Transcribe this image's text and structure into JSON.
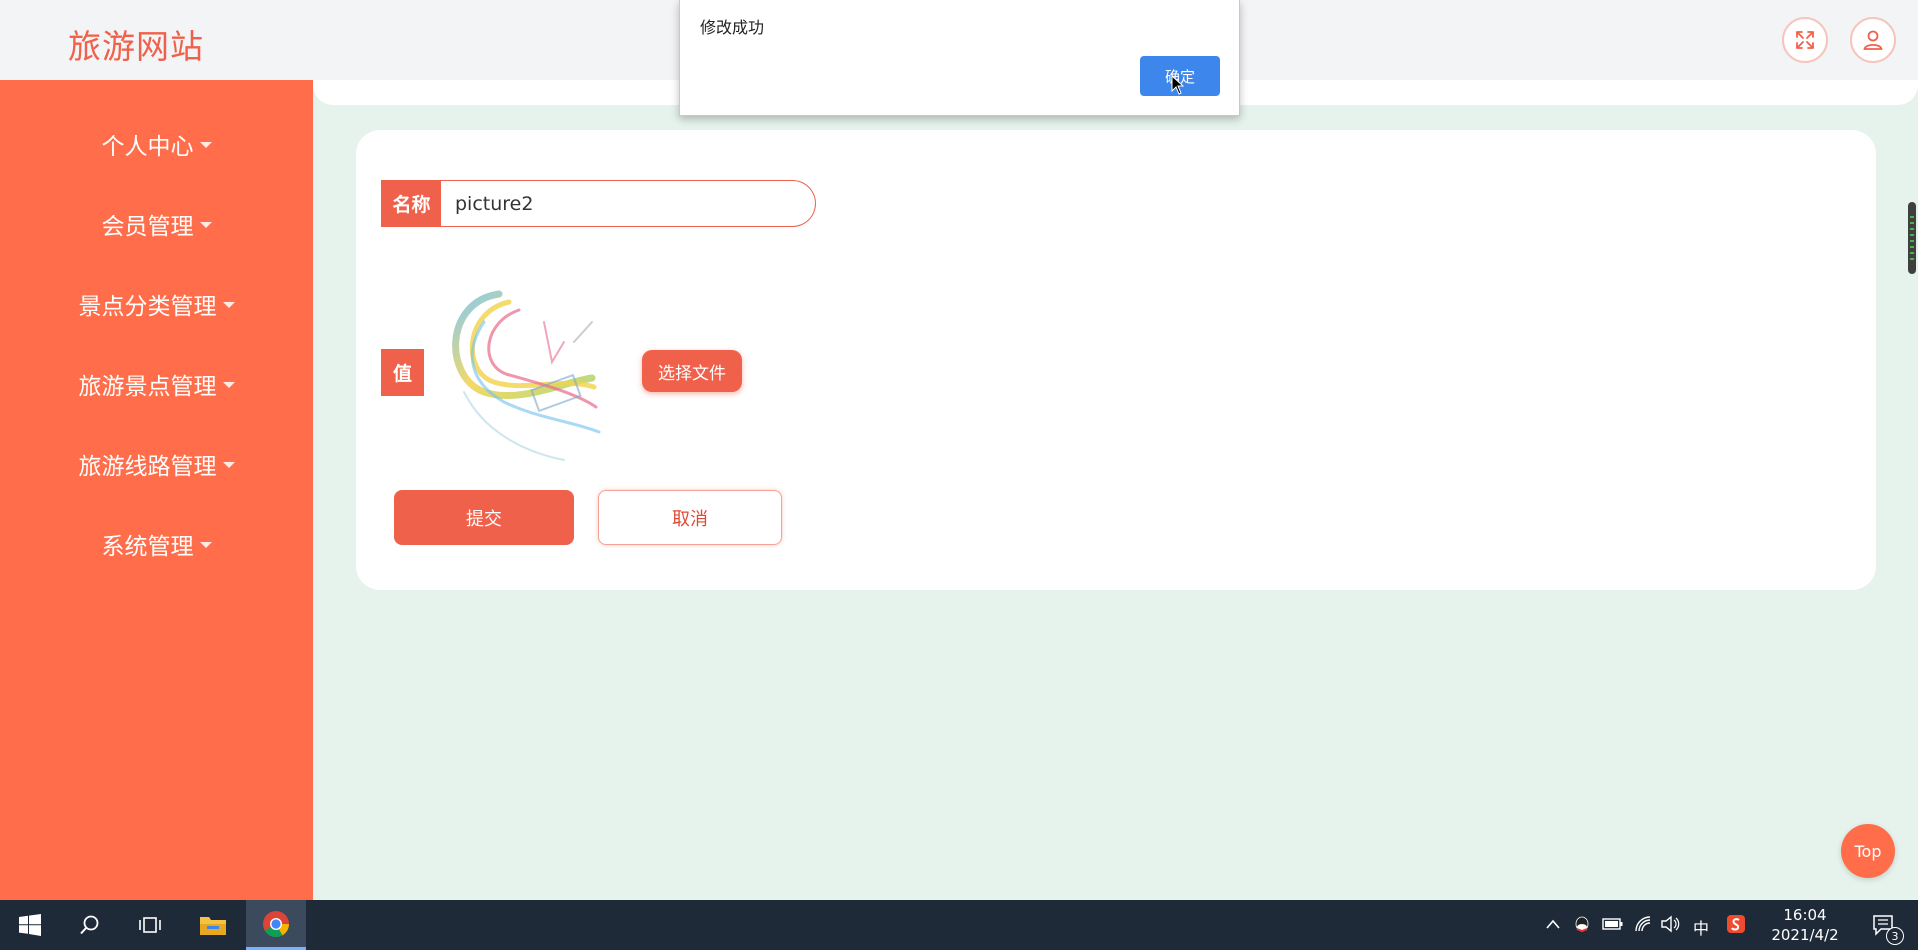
{
  "header": {
    "site_title": "旅游网站",
    "fullscreen_icon": "fullscreen-icon",
    "user_icon": "user-icon"
  },
  "sidebar": {
    "items": [
      {
        "label": "个人中心"
      },
      {
        "label": "会员管理"
      },
      {
        "label": "景点分类管理"
      },
      {
        "label": "旅游景点管理"
      },
      {
        "label": "旅游线路管理"
      },
      {
        "label": "系统管理"
      }
    ]
  },
  "form": {
    "name_label": "名称",
    "name_value": "picture2",
    "value_label": "值",
    "choose_file_label": "选择文件",
    "submit_label": "提交",
    "cancel_label": "取消"
  },
  "alert": {
    "message": "修改成功",
    "ok_label": "确定"
  },
  "top_button": {
    "label": "Top"
  },
  "taskbar": {
    "ime": "中",
    "time": "16:04",
    "date": "2021/4/2",
    "notification_count": "3"
  },
  "colors": {
    "accent": "#f0614b",
    "sidebar_bg": "#ff6d4a",
    "page_bg": "#e6f2ec",
    "alert_button": "#3d86ec"
  }
}
